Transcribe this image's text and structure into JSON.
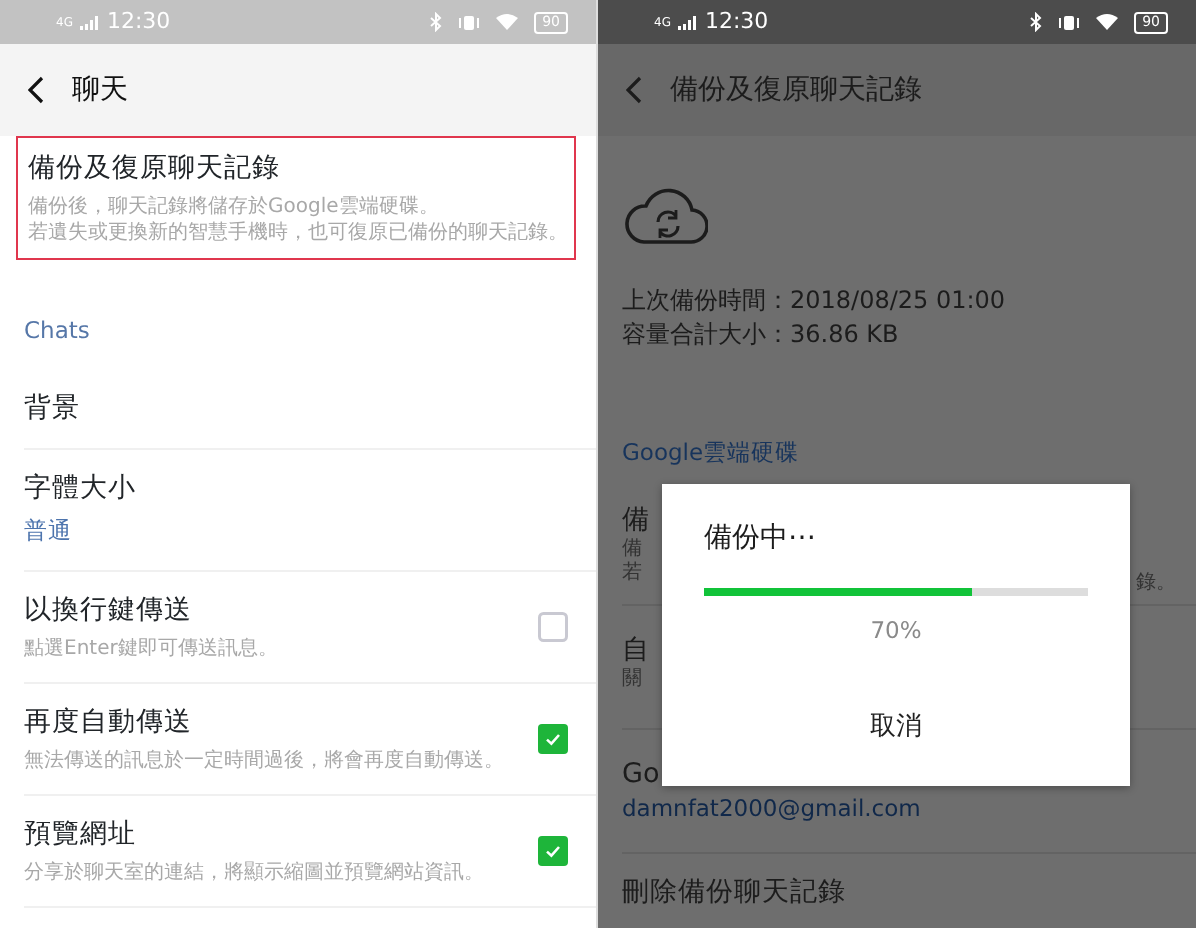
{
  "left_screen": {
    "status_bar": {
      "network": "4G",
      "time": "12:30",
      "battery": "90"
    },
    "header": {
      "title": "聊天"
    },
    "highlighted_item": {
      "title": "備份及復原聊天記錄",
      "description": [
        "備份後，聊天記錄將儲存於Google雲端硬碟。",
        "若遺失或更換新的智慧手機時，也可復原已備份的聊天記錄。"
      ]
    },
    "section_label": "Chats",
    "settings": [
      {
        "kind": "plain",
        "title": "背景"
      },
      {
        "kind": "value",
        "title": "字體大小",
        "value": "普通"
      },
      {
        "kind": "checkbox",
        "title": "以換行鍵傳送",
        "description": "點選Enter鍵即可傳送訊息。",
        "checked": false
      },
      {
        "kind": "checkbox",
        "title": "再度自動傳送",
        "description": "無法傳送的訊息於一定時間過後，將會再度自動傳送。",
        "checked": true
      },
      {
        "kind": "checkbox",
        "title": "預覽網址",
        "description": "分享於聊天室的連結，將顯示縮圖並預覽網站資訊。",
        "checked": true
      }
    ]
  },
  "right_screen": {
    "status_bar": {
      "network": "4G",
      "time": "12:30",
      "battery": "90"
    },
    "header": {
      "title": "備份及復原聊天記錄"
    },
    "backup_info": [
      "上次備份時間：2018/08/25 01:00",
      "容量合計大小：36.86 KB"
    ],
    "section_label": "Google雲端硬碟",
    "rows": [
      {
        "title": "備",
        "description": [
          "備",
          "若"
        ],
        "trailing": "錄。"
      },
      {
        "title": "自",
        "description": [
          "關"
        ]
      },
      {
        "title": "Go",
        "description": [
          "damnfat2000@gmail.com"
        ]
      },
      {
        "title": "刪除備份聊天記錄"
      }
    ],
    "dialog": {
      "title": "備份中⋯",
      "level": 0.7,
      "percent": "70%",
      "button": "取消"
    }
  }
}
